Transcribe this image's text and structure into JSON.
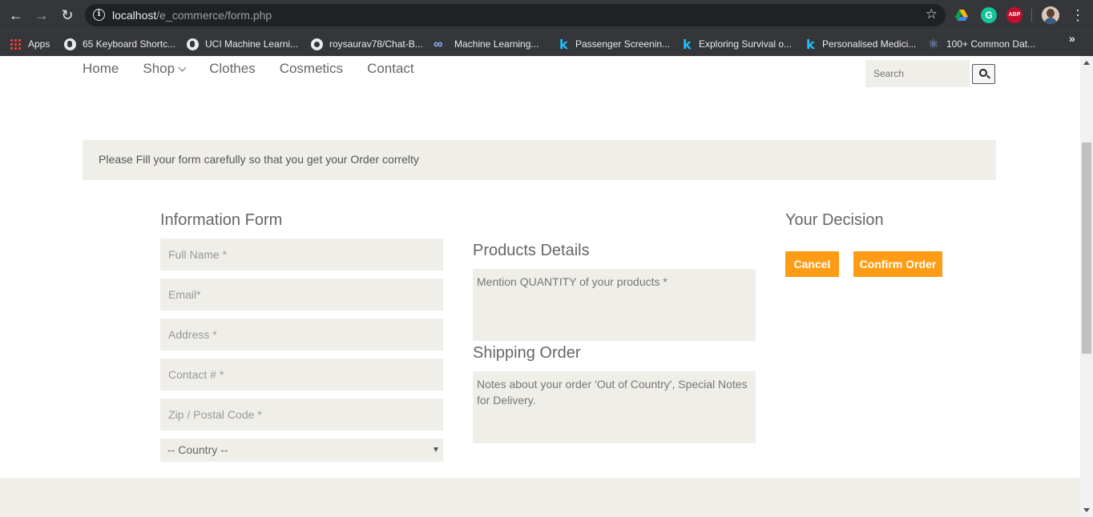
{
  "browser": {
    "url_host": "localhost",
    "url_path": "/e_commerce/form.php",
    "extensions": {
      "abp": "ABP",
      "grammarly": "G"
    },
    "bookmarks": [
      {
        "icon": "apps-icon",
        "label": "Apps"
      },
      {
        "icon": "globe-icon",
        "label": "65 Keyboard Shortc..."
      },
      {
        "icon": "globe-icon",
        "label": "UCI Machine Learni..."
      },
      {
        "icon": "github-icon",
        "label": "roysaurav78/Chat-B..."
      },
      {
        "icon": "infinity-icon",
        "label": "Machine Learning..."
      },
      {
        "icon": "kaggle-icon",
        "label": "Passenger Screenin..."
      },
      {
        "icon": "kaggle-icon",
        "label": "Exploring Survival o..."
      },
      {
        "icon": "kaggle-icon",
        "label": "Personalised Medici..."
      },
      {
        "icon": "react-icon",
        "label": "100+ Common Dat..."
      }
    ]
  },
  "nav": {
    "items": [
      "Home",
      "Shop",
      "Clothes",
      "Cosmetics",
      "Contact"
    ],
    "search_placeholder": "Search"
  },
  "notice": "Please Fill your form carefully so that you get your Order correlty",
  "info_form": {
    "title": "Information Form",
    "full_name_placeholder": "Full Name *",
    "email_placeholder": "Email*",
    "address_placeholder": "Address *",
    "contact_placeholder": "Contact # *",
    "zip_placeholder": "Zip / Postal Code *",
    "country_selected": "-- Country --"
  },
  "products": {
    "title": "Products Details",
    "placeholder": "Mention QUANTITY of your products *"
  },
  "shipping": {
    "title": "Shipping Order",
    "placeholder": "Notes about your order 'Out of Country', Special Notes for Delivery."
  },
  "decision": {
    "title": "Your Decision",
    "cancel_label": "Cancel",
    "confirm_label": "Confirm Order"
  },
  "colors": {
    "accent": "#ff9c15",
    "field_bg": "#efeee8",
    "chrome_dark": "#35363a"
  }
}
